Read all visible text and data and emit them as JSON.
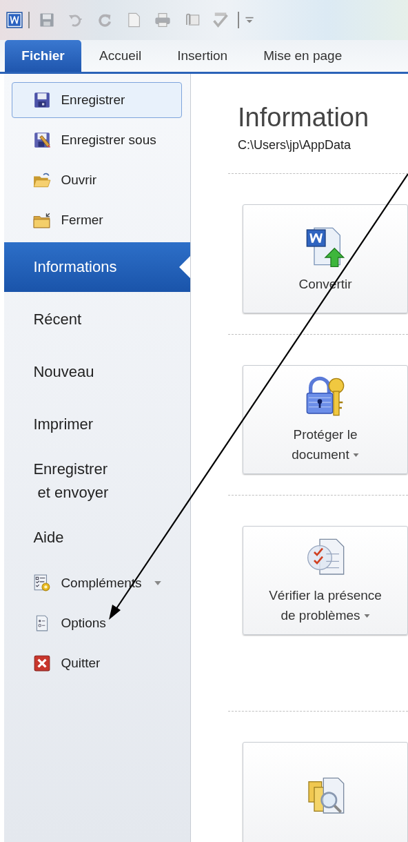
{
  "ribbon_tabs": [
    {
      "label": "Fichier",
      "selected": true
    },
    {
      "label": "Accueil",
      "selected": false
    },
    {
      "label": "Insertion",
      "selected": false
    },
    {
      "label": "Mise en page",
      "selected": false
    }
  ],
  "sidebar": {
    "items": [
      {
        "kind": "command",
        "label": "Enregistrer",
        "highlighted": true,
        "selected": false
      },
      {
        "kind": "command",
        "label": "Enregistrer sous",
        "highlighted": false,
        "selected": false
      },
      {
        "kind": "command",
        "label": "Ouvrir",
        "highlighted": false,
        "selected": false
      },
      {
        "kind": "command",
        "label": "Fermer",
        "highlighted": false,
        "selected": false
      },
      {
        "kind": "section",
        "label": "Informations",
        "highlighted": false,
        "selected": true
      },
      {
        "kind": "section",
        "label": "Récent",
        "highlighted": false,
        "selected": false
      },
      {
        "kind": "section",
        "label": "Nouveau",
        "highlighted": false,
        "selected": false
      },
      {
        "kind": "section",
        "label": "Imprimer",
        "highlighted": false,
        "selected": false
      },
      {
        "kind": "section",
        "label": "Enregistrer\n et envoyer",
        "highlighted": false,
        "selected": false
      },
      {
        "kind": "section",
        "label": "Aide",
        "highlighted": false,
        "selected": false
      },
      {
        "kind": "command",
        "label": "Compléments",
        "has_menu": true,
        "highlighted": false,
        "selected": false
      },
      {
        "kind": "command",
        "label": "Options",
        "highlighted": false,
        "selected": false
      },
      {
        "kind": "command",
        "label": "Quitter",
        "highlighted": false,
        "selected": false
      }
    ]
  },
  "content": {
    "title": "Information",
    "path": "C:\\Users\\jp\\AppData",
    "actions": [
      {
        "label": "Convertir",
        "has_menu": false
      },
      {
        "label": "Protéger le\ndocument",
        "has_menu": true
      },
      {
        "label": "Vérifier la présence\nde problèmes",
        "has_menu": true
      },
      {
        "has_menu": false
      }
    ]
  }
}
